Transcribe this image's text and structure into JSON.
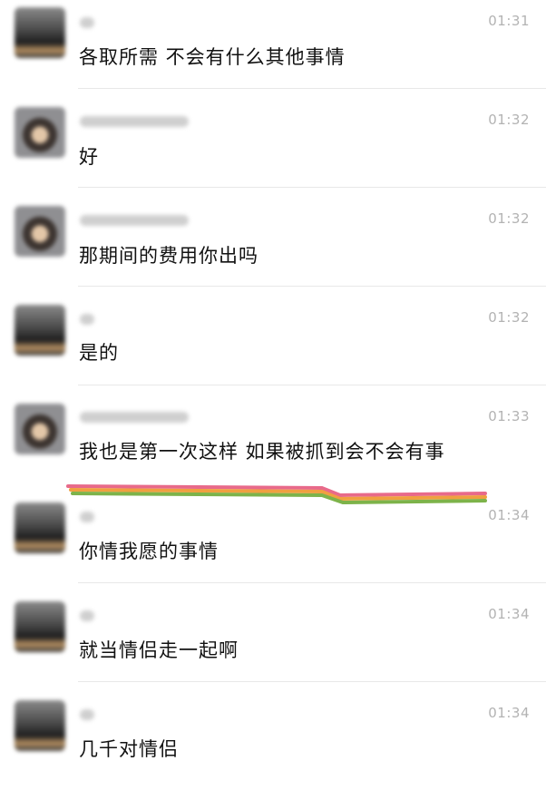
{
  "messages": [
    {
      "time": "01:31",
      "text": "各取所需 不会有什么其他事情",
      "avatar": "scenery"
    },
    {
      "time": "01:32",
      "text": "好",
      "avatar": "person"
    },
    {
      "time": "01:32",
      "text": "那期间的费用你出吗",
      "avatar": "person"
    },
    {
      "time": "01:32",
      "text": "是的",
      "avatar": "scenery"
    },
    {
      "time": "01:33",
      "text": "我也是第一次这样 如果被抓到会不会有事",
      "avatar": "person"
    },
    {
      "time": "01:34",
      "text": "你情我愿的事情",
      "avatar": "scenery"
    },
    {
      "time": "01:34",
      "text": "就当情侣走一起啊",
      "avatar": "scenery"
    },
    {
      "time": "01:34",
      "text": "几千对情侣",
      "avatar": "scenery"
    }
  ],
  "colors": {
    "rainbow": [
      "#e86a8a",
      "#f0a040",
      "#7db34a"
    ]
  }
}
